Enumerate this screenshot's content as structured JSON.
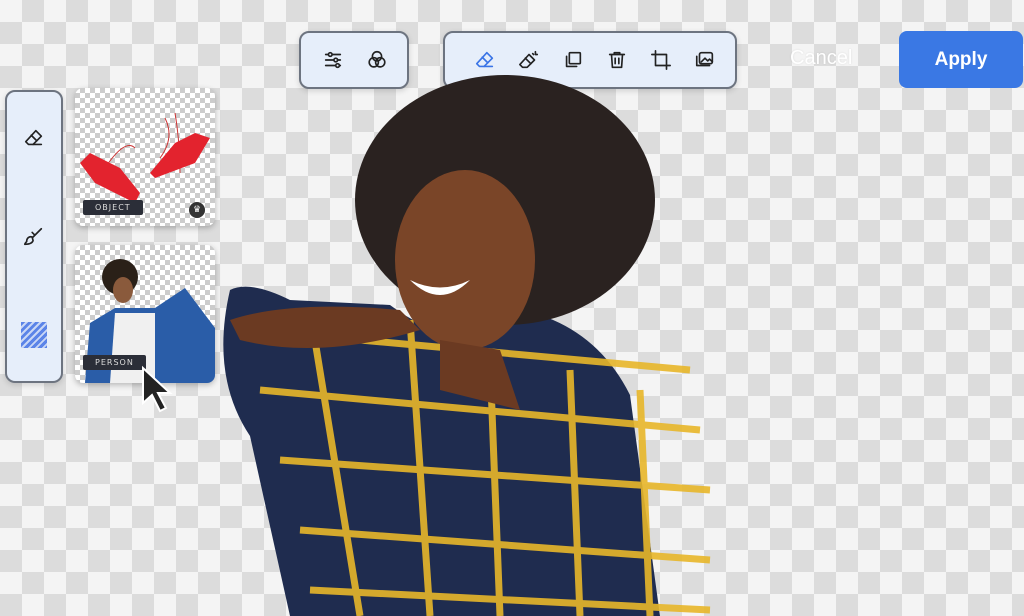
{
  "toolbar_left": {
    "icons": [
      "sliders-icon",
      "color-channels-icon"
    ]
  },
  "toolbar_main": {
    "icons": [
      "eraser-icon",
      "magic-eraser-icon",
      "layers-icon",
      "trash-icon",
      "crop-icon",
      "background-image-icon"
    ],
    "active": "eraser-icon"
  },
  "actions": {
    "cancel_label": "Cancel",
    "apply_label": "Apply"
  },
  "side_tools": {
    "icons": [
      "eraser-icon",
      "brush-icon",
      "pattern-icon"
    ]
  },
  "thumbnails": [
    {
      "label": "OBJECT",
      "badge": "crown-icon"
    },
    {
      "label": "PERSON"
    }
  ],
  "colors": {
    "accent": "#3a78e4",
    "panel": "#e6eefa"
  }
}
